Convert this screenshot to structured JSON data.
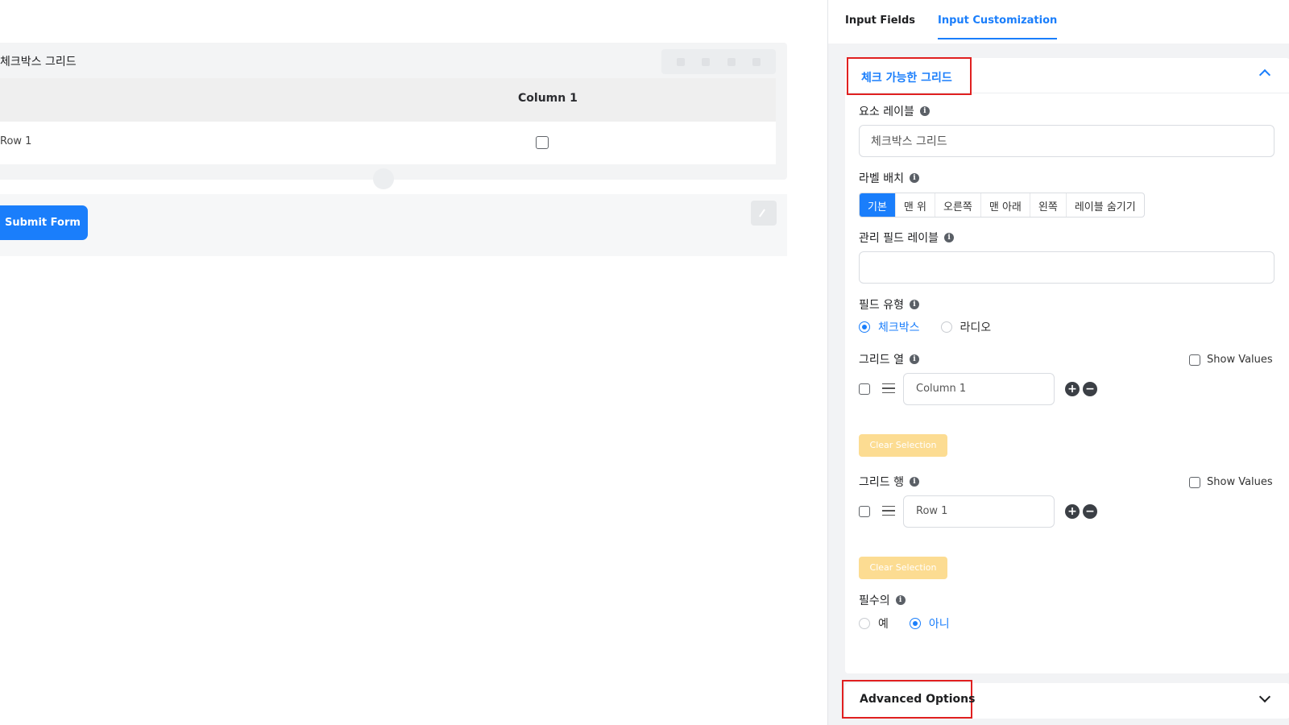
{
  "canvas": {
    "field_title": "체크박스 그리드",
    "grid_column_header": "Column 1",
    "grid_row_label": "Row 1",
    "submit_label": "Submit Form"
  },
  "tabs": [
    {
      "label": "Input Fields",
      "active": false
    },
    {
      "label": "Input Customization",
      "active": true
    }
  ],
  "section": {
    "title": "체크 가능한 그리드",
    "element_label": {
      "label": "요소 레이블",
      "value": "체크박스 그리드"
    },
    "label_placement": {
      "label": "라벨 배치",
      "options": [
        "기본",
        "맨 위",
        "오른쪽",
        "맨 아래",
        "왼쪽",
        "레이블 숨기기"
      ],
      "selected": "기본"
    },
    "admin_label": {
      "label": "관리 필드 레이블",
      "value": ""
    },
    "field_type": {
      "label": "필드 유형",
      "options": [
        "체크박스",
        "라디오"
      ],
      "selected": "체크박스"
    },
    "grid_columns": {
      "label": "그리드 열",
      "show_values": "Show Values",
      "items": [
        "Column 1"
      ],
      "clear": "Clear Selection"
    },
    "grid_rows": {
      "label": "그리드 행",
      "show_values": "Show Values",
      "items": [
        "Row 1"
      ],
      "clear": "Clear Selection"
    },
    "required": {
      "label": "필수의",
      "options": [
        "예",
        "아니"
      ],
      "selected": "아니"
    }
  },
  "advanced": {
    "title": "Advanced Options"
  },
  "colors": {
    "accent": "#1a7efb",
    "highlight_box": "#e02020",
    "clear_button": "#fcdc92"
  },
  "icons": [
    "info-icon",
    "chevron-up-icon",
    "chevron-down-icon",
    "drag-handle-icon",
    "plus-icon",
    "minus-icon",
    "edit-icon"
  ]
}
